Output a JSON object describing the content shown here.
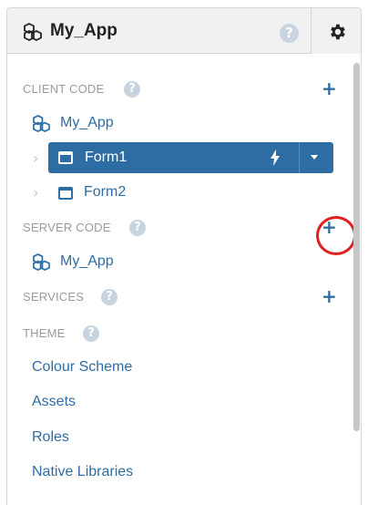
{
  "header": {
    "app_name": "My_App",
    "help_symbol": "?",
    "settings_icon": "gear-icon"
  },
  "sections": {
    "client_code": {
      "label": "CLIENT CODE",
      "help_symbol": "?",
      "add_symbol": "+",
      "items": [
        {
          "label": "My_App",
          "icon": "modules-icon"
        },
        {
          "label": "Form1",
          "icon": "window-icon",
          "selected": true
        },
        {
          "label": "Form2",
          "icon": "window-icon"
        }
      ]
    },
    "server_code": {
      "label": "SERVER CODE",
      "help_symbol": "?",
      "add_symbol": "+",
      "items": [
        {
          "label": "My_App",
          "icon": "modules-icon"
        }
      ]
    },
    "services": {
      "label": "SERVICES",
      "help_symbol": "?",
      "add_symbol": "+"
    },
    "theme": {
      "label": "THEME",
      "help_symbol": "?",
      "items": [
        {
          "label": "Colour Scheme"
        },
        {
          "label": "Assets"
        },
        {
          "label": "Roles"
        },
        {
          "label": "Native Libraries"
        }
      ]
    }
  },
  "colors": {
    "accent": "#2e6da4",
    "highlight_ring": "#e0201f",
    "section_label": "#9a9a9a"
  }
}
